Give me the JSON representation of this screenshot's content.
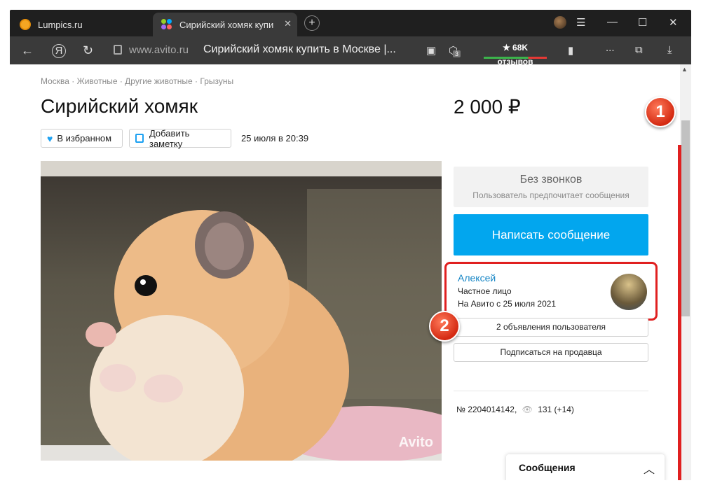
{
  "browser": {
    "tabs": [
      {
        "label": "Lumpics.ru"
      },
      {
        "label": "Сирийский хомяк купи"
      }
    ],
    "url_domain": "www.avito.ru",
    "url_title": "Сирийский хомяк купить в Москве |...",
    "reviews_label": "★ 68K отзывов",
    "tab_badge": "3",
    "ext_more": "...",
    "new_tab": "+",
    "tab_close": "✕"
  },
  "page": {
    "breadcrumb": "Москва · Животные · Другие животные · Грызуны",
    "title": "Сирийский хомяк",
    "price": "2 000 ₽",
    "favorite_label": "В избранном",
    "note_label": "Добавить заметку",
    "date": "25 июля в 20:39",
    "watermark": "Avito",
    "no_calls_title": "Без звонков",
    "no_calls_sub": "Пользователь предпочитает сообщения",
    "write_message": "Написать сообщение",
    "seller": {
      "name": "Алексей",
      "type": "Частное лицо",
      "since": "На Авито с 25 июля 2021"
    },
    "user_ads": "2 объявления пользователя",
    "subscribe": "Подписаться на продавца",
    "ad_number": "№ 2204014142,",
    "views": "131 (+14)",
    "messages_panel": "Сообщения"
  },
  "annotations": {
    "marker1": "1",
    "marker2": "2",
    "accent": "#e02020"
  }
}
